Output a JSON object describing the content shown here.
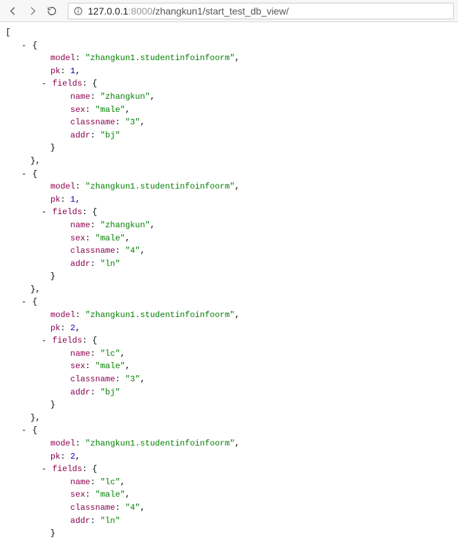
{
  "browser": {
    "url_host_dim": "127.0.0.1",
    "url_port_dim": ":8000",
    "url_path": "/zhangkun1/start_test_db_view/"
  },
  "json_records": [
    {
      "model": "zhangkun1.studentinfoinfoorm",
      "pk": 1,
      "fields": {
        "name": "zhangkun",
        "sex": "male",
        "classname": "3",
        "addr": "bj"
      }
    },
    {
      "model": "zhangkun1.studentinfoinfoorm",
      "pk": 1,
      "fields": {
        "name": "zhangkun",
        "sex": "male",
        "classname": "4",
        "addr": "ln"
      }
    },
    {
      "model": "zhangkun1.studentinfoinfoorm",
      "pk": 2,
      "fields": {
        "name": "lc",
        "sex": "male",
        "classname": "3",
        "addr": "bj"
      }
    },
    {
      "model": "zhangkun1.studentinfoinfoorm",
      "pk": 2,
      "fields": {
        "name": "lc",
        "sex": "male",
        "classname": "4",
        "addr": "ln"
      }
    }
  ],
  "labels": {
    "model": "model",
    "pk": "pk",
    "fields": "fields",
    "name": "name",
    "sex": "sex",
    "classname": "classname",
    "addr": "addr"
  }
}
